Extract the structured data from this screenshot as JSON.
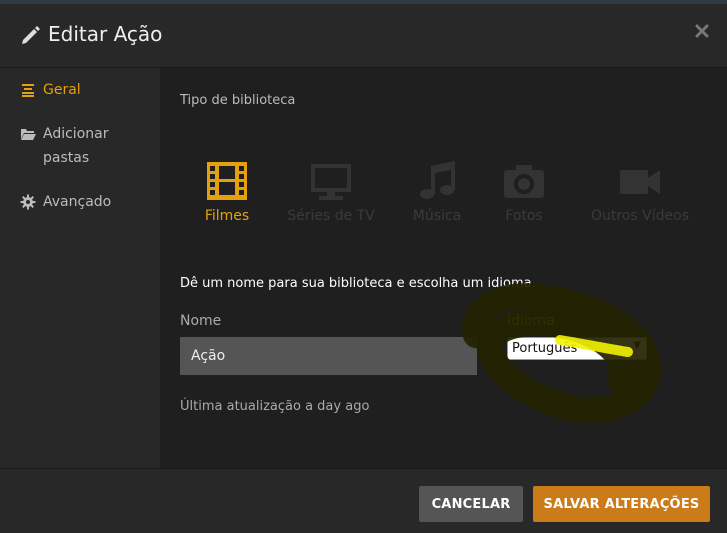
{
  "header": {
    "title": "Editar Ação",
    "edit_icon": "pencil-icon",
    "close_icon": "close-icon"
  },
  "sidebar": {
    "items": [
      {
        "label": "Geral",
        "icon": "list-icon",
        "active": true
      },
      {
        "label": "Adicionar pastas",
        "icon": "folder-icon",
        "active": false
      },
      {
        "label": "Avançado",
        "icon": "gear-icon",
        "active": false
      }
    ]
  },
  "main": {
    "section_label": "Tipo de biblioteca",
    "library_types": [
      {
        "label": "Filmes",
        "icon": "film-icon",
        "active": true
      },
      {
        "label": "Séries de TV",
        "icon": "tv-icon",
        "active": false
      },
      {
        "label": "Música",
        "icon": "music-icon",
        "active": false
      },
      {
        "label": "Fotos",
        "icon": "camera-icon",
        "active": false
      },
      {
        "label": "Outros Vídeos",
        "icon": "video-camera-icon",
        "active": false
      }
    ],
    "instructions": "Dê um nome para sua biblioteca e escolha um idioma.",
    "name_label": "Nome",
    "name_value": "Ação",
    "language_label": "Idioma",
    "language_value": "Português",
    "last_updated": "Última atualização a day ago"
  },
  "footer": {
    "cancel_label": "CANCELAR",
    "save_label": "SALVAR ALTERAÇÕES"
  },
  "colors": {
    "accent": "#e5a00d",
    "save_button": "#cc7b19",
    "cancel_button": "#555555",
    "highlight_scribble": "#f2f200"
  }
}
